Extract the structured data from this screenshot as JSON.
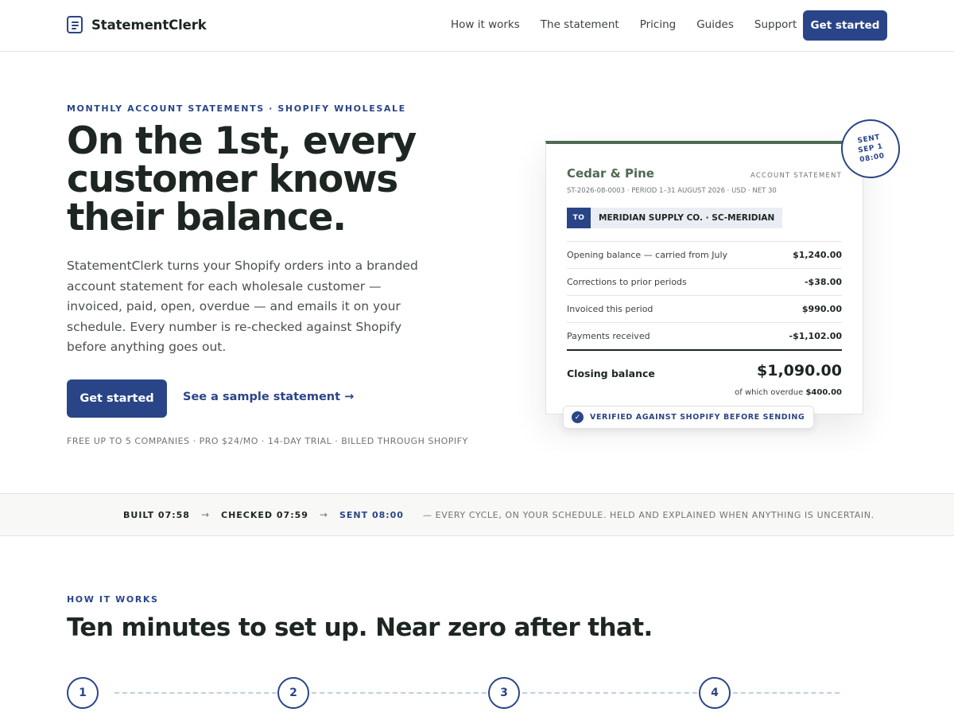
{
  "brand": {
    "name": "StatementClerk"
  },
  "nav": {
    "items": [
      "How it works",
      "The statement",
      "Pricing",
      "Guides",
      "Support"
    ],
    "cta": "Get started"
  },
  "hero": {
    "eyebrow": "MONTHLY ACCOUNT STATEMENTS · SHOPIFY WHOLESALE",
    "title": "On the 1st, every customer knows their balance.",
    "description": "StatementClerk turns your Shopify orders into a branded account statement for each wholesale customer — invoiced, paid, open, overdue — and emails it on your schedule. Every number is re-checked against Shopify before anything goes out.",
    "cta_primary": "Get started",
    "cta_secondary": "See a sample statement →",
    "pricing_note": "FREE UP TO 5 COMPANIES · PRO $24/MO · 14-DAY TRIAL · BILLED THROUGH SHOPIFY"
  },
  "statement": {
    "company": "Cedar & Pine",
    "doc_type": "ACCOUNT STATEMENT",
    "meta": "ST-2026-08-0003 · PERIOD 1–31 AUGUST 2026 · USD · NET 30",
    "to_label": "TO",
    "to_value": "MERIDIAN SUPPLY CO. · SC-MERIDIAN",
    "rows": [
      {
        "label": "Opening balance — carried from July",
        "value": "$1,240.00"
      },
      {
        "label": "Corrections to prior periods",
        "value": "-$38.00"
      },
      {
        "label": "Invoiced this period",
        "value": "$990.00"
      },
      {
        "label": "Payments received",
        "value": "-$1,102.00"
      }
    ],
    "closing_label": "Closing balance",
    "closing_value": "$1,090.00",
    "overdue_prefix": "of which overdue",
    "overdue_value": "$400.00",
    "stamp": {
      "line1": "SENT",
      "line2": "SEP 1",
      "line3": "08:00"
    },
    "verified": "VERIFIED AGAINST SHOPIFY BEFORE SENDING"
  },
  "timeline": {
    "steps": [
      "BUILT 07:58",
      "CHECKED 07:59",
      "SENT 08:00"
    ],
    "note": "— EVERY CYCLE, ON YOUR SCHEDULE. HELD AND EXPLAINED WHEN ANYTHING IS UNCERTAIN."
  },
  "how_it_works": {
    "eyebrow": "HOW IT WORKS",
    "title": "Ten minutes to set up. Near zero after that.",
    "steps": [
      "1",
      "2",
      "3",
      "4"
    ]
  },
  "colors": {
    "accent": "#2a4587",
    "brand_green": "#4f6a52",
    "text": "#1d2620",
    "muted": "#6f7570"
  }
}
